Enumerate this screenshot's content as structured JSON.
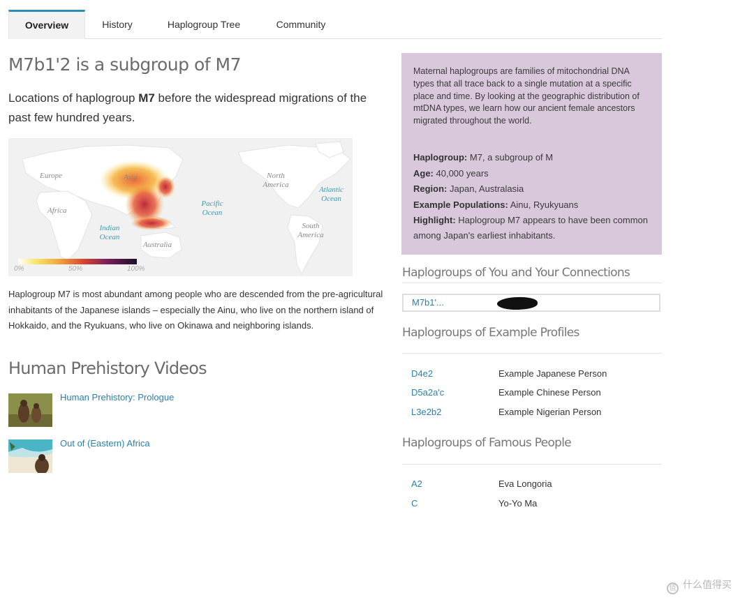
{
  "tabs": [
    {
      "label": "Overview",
      "active": true
    },
    {
      "label": "History",
      "active": false
    },
    {
      "label": "Haplogroup Tree",
      "active": false
    },
    {
      "label": "Community",
      "active": false
    }
  ],
  "page_title": "M7b1'2 is a subgroup of M7",
  "map_section": {
    "lead_prefix": "Locations of haplogroup ",
    "lead_bold": "M7",
    "lead_suffix": " before the widespread migrations of the past few hundred years.",
    "labels": {
      "europe": "Europe",
      "asia": "Asia",
      "africa": "Africa",
      "north_america": "North America",
      "atlantic": "Atlantic Ocean",
      "pacific": "Pacific Ocean",
      "indian": "Indian Ocean",
      "south_america": "South America",
      "australia": "Australia"
    },
    "scale": {
      "min": "0%",
      "mid": "50%",
      "max": "100%"
    }
  },
  "description": "Haplogroup M7 is most abundant among people who are descended from the pre-agricultural inhabitants of the Japanese islands – especially the Ainu, who live on the northern island of Hokkaido, and the Ryukuans, who live on Okinawa and neighboring islands.",
  "videos": {
    "heading": "Human Prehistory Videos",
    "items": [
      {
        "title": "Human Prehistory: Prologue"
      },
      {
        "title": "Out of (Eastern) Africa"
      }
    ]
  },
  "infobox": {
    "intro": "Maternal haplogroups are families of mitochondrial DNA types that all trace back to a single mutation at a specific place and time. By looking at the geographic distribution of mtDNA types, we learn how our ancient female ancestors migrated throughout the world.",
    "haplogroup_label": "Haplogroup:",
    "haplogroup_value": " M7, a subgroup of M",
    "age_label": "Age:",
    "age_value": " 40,000 years",
    "region_label": "Region:",
    "region_value": " Japan, Australasia",
    "populations_label": "Example Populations:",
    "populations_value": " Ainu, Ryukyuans",
    "highlight_label": "Highlight:",
    "highlight_value": " Haplogroup M7 appears to have been common among Japan's earliest inhabitants."
  },
  "connections": {
    "heading": "Haplogroups of You and Your Connections",
    "value": "M7b1'..."
  },
  "example_profiles": {
    "heading": "Haplogroups of Example Profiles",
    "rows": [
      {
        "haplogroup": "D4e2",
        "name": "Example Japanese Person"
      },
      {
        "haplogroup": "D5a2a'c",
        "name": "Example Chinese Person"
      },
      {
        "haplogroup": "L3e2b2",
        "name": "Example Nigerian Person"
      }
    ]
  },
  "famous_people": {
    "heading": "Haplogroups of Famous People",
    "rows": [
      {
        "haplogroup": "A2",
        "name": "Eva Longoria"
      },
      {
        "haplogroup": "C",
        "name": "Yo-Yo Ma"
      }
    ]
  },
  "watermark": {
    "text": "什么值得买",
    "icon_glyph": "值"
  }
}
